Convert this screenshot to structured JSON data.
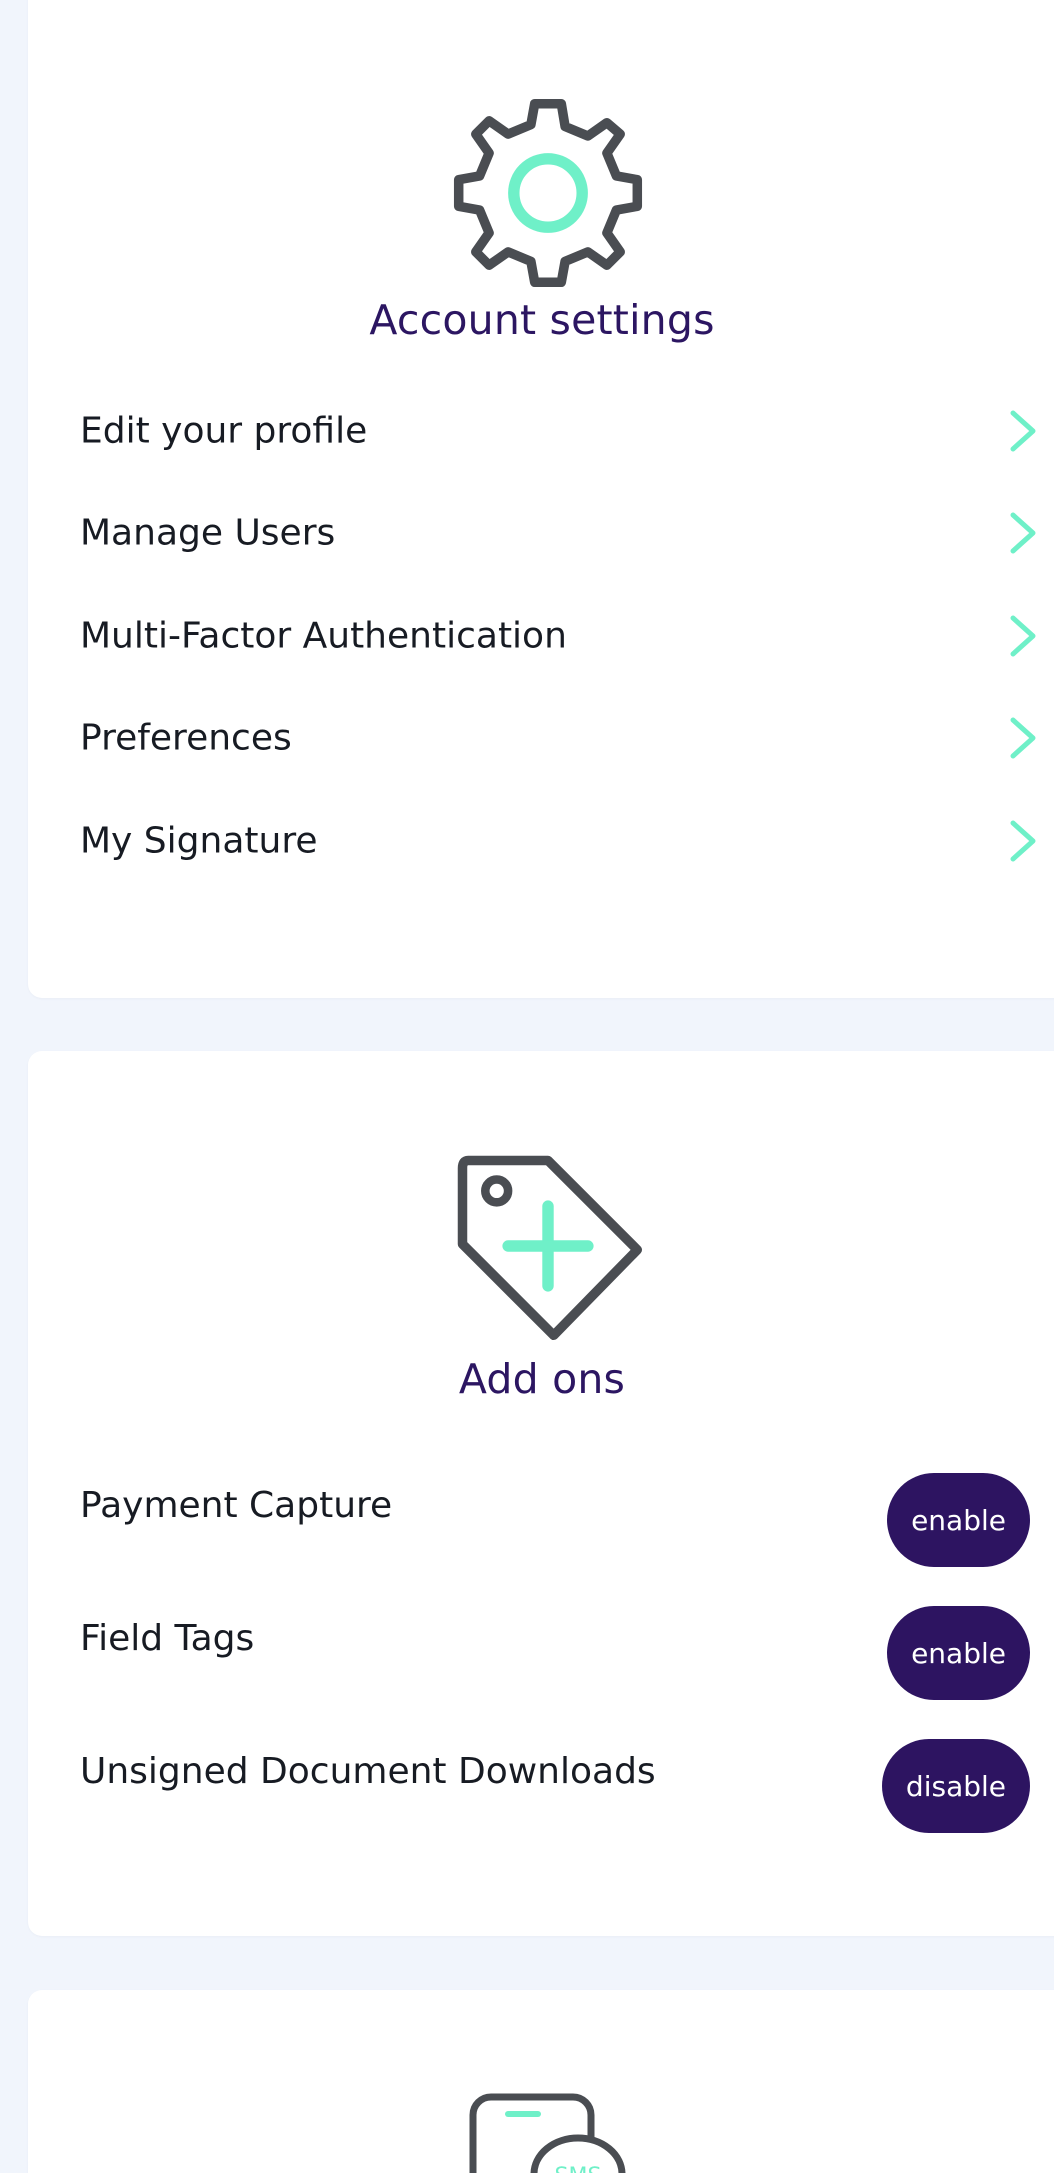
{
  "account_settings": {
    "icon": "gear-icon",
    "title": "Account settings",
    "items": [
      {
        "label": "Edit your profile",
        "icon": "chevron-right-icon"
      },
      {
        "label": "Manage Users",
        "icon": "chevron-right-icon"
      },
      {
        "label": "Multi-Factor Authentication",
        "icon": "chevron-right-icon"
      },
      {
        "label": "Preferences",
        "icon": "chevron-right-icon"
      },
      {
        "label": "My Signature",
        "icon": "chevron-right-icon"
      }
    ]
  },
  "add_ons": {
    "icon": "tag-plus-icon",
    "title": "Add ons",
    "items": [
      {
        "label": "Payment Capture",
        "button_label": "enable"
      },
      {
        "label": "Field Tags",
        "button_label": "enable"
      },
      {
        "label": "Unsigned Document Downloads",
        "button_label": "disable"
      }
    ]
  },
  "sms_card": {
    "icon": "sms-phone-icon",
    "icon_text": "SMS"
  },
  "colors": {
    "page_background": "#f1f5fc",
    "card_background": "#ffffff",
    "title_color": "#2c1662",
    "text_color": "#171b23",
    "accent_mint": "#6ff0c8",
    "icon_outline": "#4a4d52",
    "button_background": "#2d1461",
    "button_text": "#ffffff"
  }
}
